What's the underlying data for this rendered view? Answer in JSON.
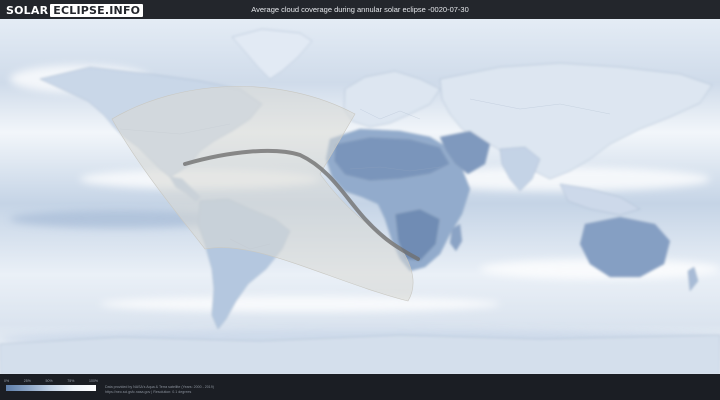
{
  "brand": {
    "part1": "SOLAR",
    "part2": "ECLIPSE.INFO"
  },
  "title": "Average cloud coverage during annular solar eclipse -0020-07-30",
  "legend": {
    "ticks": [
      "0%",
      "25%",
      "50%",
      "75%",
      "100%"
    ]
  },
  "credits": {
    "line1": "Data provided by NASA's Aqua & Terra satellite (Years: 2000 - 2019)",
    "line2": "https://neo.sci.gsfc.nasa.gov | Resolution: 0.1 degrees"
  },
  "colors": {
    "cloud_free": "#5f7fab",
    "cloudy": "#ffffff",
    "visibility_zone": "#d9d8d3",
    "eclipse_path": "#707070"
  }
}
